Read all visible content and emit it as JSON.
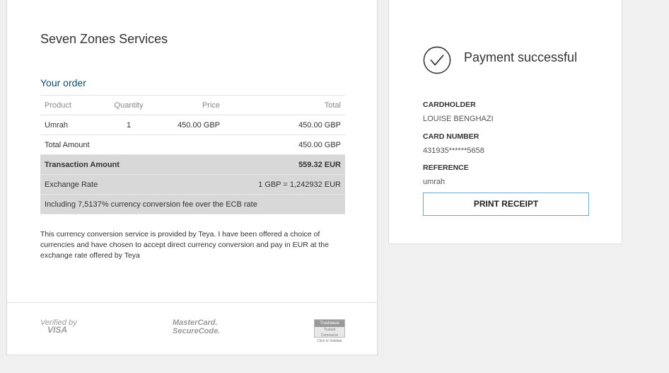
{
  "merchant_name": "Seven Zones Services",
  "order": {
    "title": "Your order",
    "headers": {
      "product": "Product",
      "quantity": "Quantity",
      "price": "Price",
      "total": "Total"
    },
    "items": [
      {
        "product": "Umrah",
        "quantity": "1",
        "price": "450.00 GBP",
        "total": "450.00 GBP"
      }
    ],
    "total_amount": {
      "label": "Total Amount",
      "value": "450.00 GBP"
    },
    "transaction_amount": {
      "label": "Transaction Amount",
      "value": "559.32 EUR"
    },
    "exchange_rate": {
      "label": "Exchange Rate",
      "value": "1 GBP = 1,242932 EUR"
    },
    "fee_note": "Including 7,5137% currency conversion fee over the ECB rate"
  },
  "disclaimer": "This currency conversion service is provided by Teya. I have been offered a choice of currencies and have chosen to accept direct currency conversion and pay in EUR at the exchange rate offered by Teya",
  "footer_badges": {
    "visa_line1": "Verified by",
    "visa_line2": "VISA",
    "mc_line1": "MasterCard.",
    "mc_line2": "SecureCode.",
    "trustwave_line1": "Trustwave",
    "trustwave_line2": "Trusted Commerce",
    "trustwave_line3": "Click to Validate"
  },
  "payment": {
    "status": "Payment successful",
    "cardholder_label": "CARDHOLDER",
    "cardholder_value": "LOUISE BENGHAZI",
    "card_number_label": "CARD NUMBER",
    "card_number_value": "431935******5658",
    "reference_label": "REFERENCE",
    "reference_value": "umrah",
    "print_button": "PRINT RECEIPT"
  },
  "colors": {
    "accent": "#0b4f6c",
    "button_border": "#6aa7cf",
    "grey_row": "#d8d8d8",
    "background": "#f0f0f0"
  }
}
